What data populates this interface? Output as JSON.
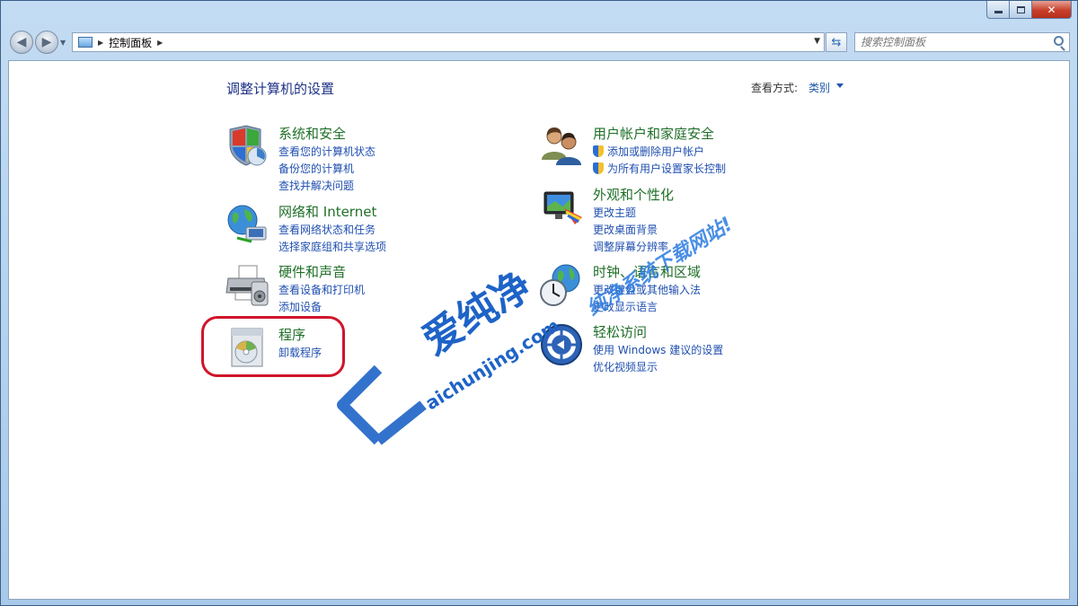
{
  "breadcrumb": {
    "root": "控制面板"
  },
  "search": {
    "placeholder": "搜索控制面板"
  },
  "header": {
    "title": "调整计算机的设置",
    "view_by_label": "查看方式:",
    "view_by_value": "类别"
  },
  "categories_left": [
    {
      "title": "系统和安全",
      "icon": "system-security-icon",
      "links": [
        "查看您的计算机状态",
        "备份您的计算机",
        "查找并解决问题"
      ]
    },
    {
      "title": "网络和 Internet",
      "icon": "network-globe-icon",
      "links": [
        "查看网络状态和任务",
        "选择家庭组和共享选项"
      ]
    },
    {
      "title": "硬件和声音",
      "icon": "printer-icon",
      "links": [
        "查看设备和打印机",
        "添加设备"
      ]
    },
    {
      "title": "程序",
      "icon": "programs-icon",
      "links": [
        "卸载程序"
      ]
    }
  ],
  "categories_right": [
    {
      "title": "用户帐户和家庭安全",
      "icon": "users-icon",
      "links": [
        "添加或删除用户帐户",
        "为所有用户设置家长控制"
      ]
    },
    {
      "title": "外观和个性化",
      "icon": "display-personalize-icon",
      "links": [
        "更改主题",
        "更改桌面背景",
        "调整屏幕分辨率"
      ]
    },
    {
      "title": "时钟、语言和区域",
      "icon": "clock-globe-icon",
      "links": [
        "更改键盘或其他输入法",
        "更改显示语言"
      ]
    },
    {
      "title": "轻松访问",
      "icon": "ease-of-access-icon",
      "links": [
        "使用 Windows 建议的设置",
        "优化视频显示"
      ]
    }
  ],
  "watermark": {
    "brand": "爱纯净",
    "domain": "aichunjing.com",
    "handwritten": "纯净系统下载网站!"
  }
}
